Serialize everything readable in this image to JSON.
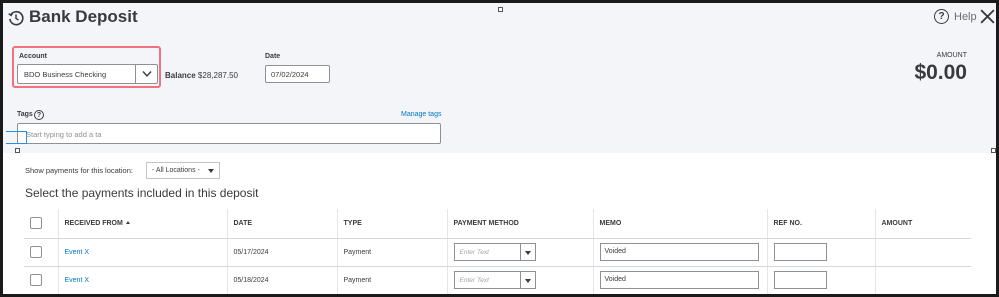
{
  "dialog": {
    "title": "Bank Deposit",
    "help_label": "Help",
    "icons": {
      "history": "history-icon",
      "help": "help-circle-icon",
      "close": "close-icon"
    }
  },
  "account": {
    "label": "Account",
    "value": "BDO Business Checking",
    "balance_label": "Balance",
    "balance_value": "$28,287.50"
  },
  "date": {
    "label": "Date",
    "value": "07/02/2024"
  },
  "amount": {
    "label": "AMOUNT",
    "value": "$0.00"
  },
  "tags": {
    "label": "Tags",
    "manage_label": "Manage tags",
    "placeholder": "Start typing to add a ta"
  },
  "location": {
    "label": "Show payments for this location:",
    "value": "- All Locations -"
  },
  "payments": {
    "section_title": "Select the payments included in this deposit",
    "columns": [
      "RECEIVED FROM",
      "DATE",
      "TYPE",
      "PAYMENT METHOD",
      "MEMO",
      "REF NO.",
      "AMOUNT"
    ],
    "rows": [
      {
        "received_from": "Event X",
        "date": "05/17/2024",
        "type": "Payment",
        "payment_method_placeholder": "Enter Text",
        "memo": "Voided",
        "ref_no": "",
        "amount": ""
      },
      {
        "received_from": "Event X",
        "date": "05/18/2024",
        "type": "Payment",
        "payment_method_placeholder": "Enter Text",
        "memo": "Voided",
        "ref_no": "",
        "amount": ""
      }
    ]
  },
  "colors": {
    "accent_link": "#0077c5",
    "highlight_border": "#f0747d",
    "header_bg": "#f4f5f8",
    "text": "#393a3d"
  }
}
